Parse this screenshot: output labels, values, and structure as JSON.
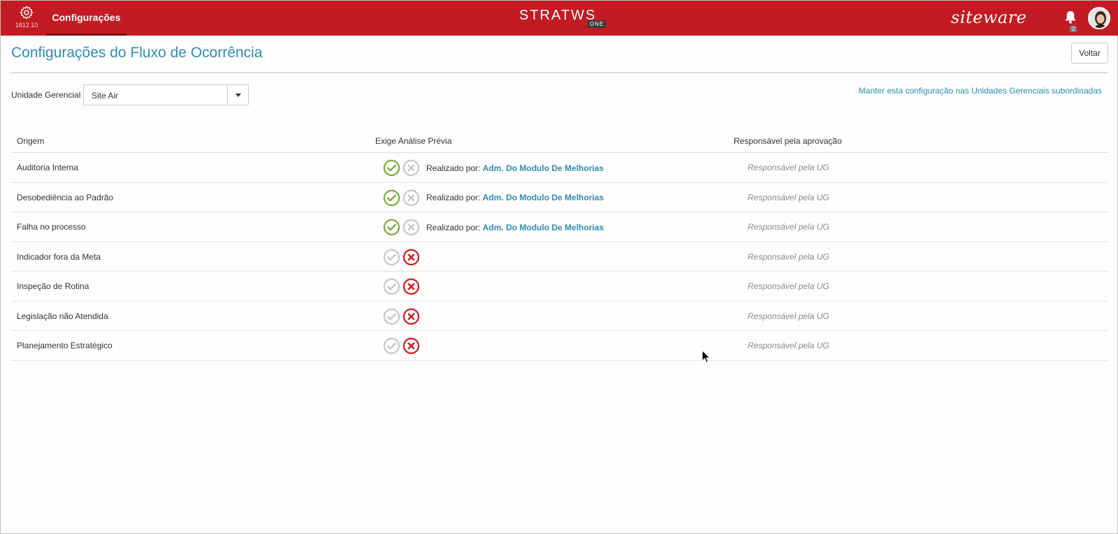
{
  "header": {
    "version": "1812.10",
    "nav_tab": "Configurações",
    "brand": "STRATWS",
    "brand_badge": "ONE",
    "partner_logo": "siteware",
    "notification_count": "2"
  },
  "page": {
    "title": "Configurações do Fluxo de Ocorrência",
    "back_label": "Voltar"
  },
  "filter": {
    "label": "Unidade Gerencial",
    "selected": "Site Air",
    "keep_link": "Manter esta configuração nas Unidades Gerenciais subordinadas"
  },
  "table": {
    "headers": {
      "origem": "Origem",
      "exige": "Exige Análise Prévia",
      "responsavel": "Responsável pela aprovação"
    },
    "realizado_prefix": "Realizado por:",
    "rows": [
      {
        "origem": "Auditoria Interna",
        "exige": true,
        "realizado_por": "Adm. Do Modulo De Melhorias",
        "responsavel": "Responsável pela UG"
      },
      {
        "origem": "Desobediência ao Padrão",
        "exige": true,
        "realizado_por": "Adm. Do Modulo De Melhorias",
        "responsavel": "Responsável pela UG"
      },
      {
        "origem": "Falha no processo",
        "exige": true,
        "realizado_por": "Adm. Do Modulo De Melhorias",
        "responsavel": "Responsável pela UG"
      },
      {
        "origem": "Indicador fora da Meta",
        "exige": false,
        "responsavel": "Responsável pela UG"
      },
      {
        "origem": "Inspeção de Rotina",
        "exige": false,
        "responsavel": "Responsável pela UG"
      },
      {
        "origem": "Legislação não Atendida",
        "exige": false,
        "responsavel": "Responsável pela UG"
      },
      {
        "origem": "Planejamento Estratégico",
        "exige": false,
        "responsavel": "Responsável pela UG"
      }
    ]
  },
  "colors": {
    "header_bg": "#c31b23",
    "accent_blue": "#2e8bb3",
    "yes_green": "#7cb03a",
    "no_red": "#d0202a",
    "inactive_gray": "#c8c8c8"
  },
  "icons": {
    "settings": "gear-icon",
    "notifications": "bell-icon",
    "yes": "check-circle-icon",
    "no": "x-circle-icon"
  }
}
